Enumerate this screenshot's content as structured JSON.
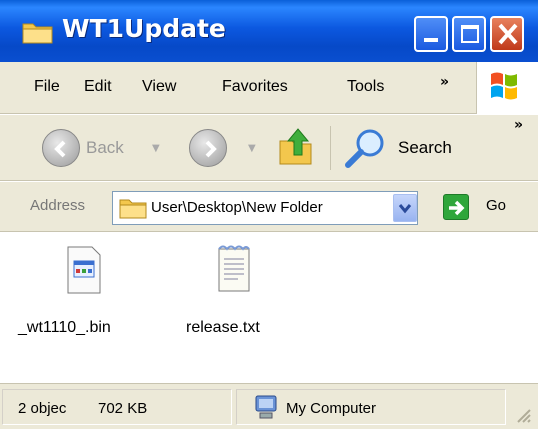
{
  "window": {
    "title": "WT1Update",
    "title_icon": "folder-icon",
    "controls": {
      "minimize_icon": "minimize-icon",
      "maximize_icon": "maximize-icon",
      "close_icon": "close-icon"
    }
  },
  "menubar": {
    "items": [
      "File",
      "Edit",
      "View",
      "Favorites",
      "Tools"
    ],
    "overflow": "»"
  },
  "toolbar": {
    "back_label": "Back",
    "search_label": "Search",
    "overflow": "»"
  },
  "address": {
    "label": "Address",
    "value": "User\\Desktop\\New Folder",
    "go_label": "Go"
  },
  "files": [
    {
      "name": "_wt1110_.bin",
      "icon": "bin-file-icon"
    },
    {
      "name": "release.txt",
      "icon": "text-file-icon"
    }
  ],
  "statusbar": {
    "objects": "2 objec",
    "size": "702 KB",
    "zone": "My Computer"
  },
  "colors": {
    "titlebar": "#0a4fd0",
    "chrome": "#ece9d8",
    "close_button": "#c0391a",
    "go_button": "#2fa63b"
  }
}
